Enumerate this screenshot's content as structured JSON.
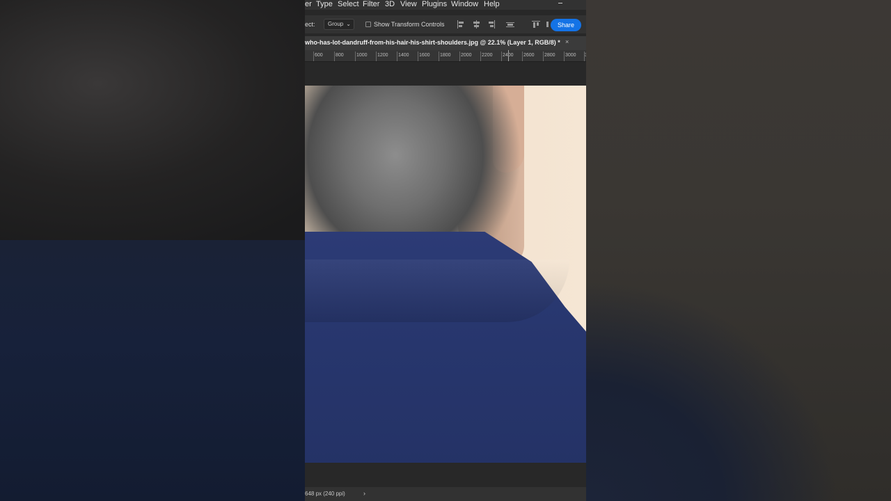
{
  "menu": [
    "er",
    "Type",
    "Select",
    "Filter",
    "3D",
    "View",
    "Plugins",
    "Window",
    "Help"
  ],
  "options": {
    "label": "ect:",
    "select_value": "Group",
    "checkbox_label": "Show Transform Controls",
    "share_label": "Share"
  },
  "document": {
    "tab_title": "who-has-lot-dandruff-from-his-hair-his-shirt-shoulders.jpg @ 22.1% (Layer 1, RGB/8) *",
    "close_glyph": "×"
  },
  "ruler": [
    "600",
    "800",
    "1000",
    "1200",
    "1400",
    "1600",
    "1800",
    "2000",
    "2200",
    "2400",
    "2600",
    "2800",
    "3000",
    "3"
  ],
  "status": {
    "text": "648 px (240 ppi)",
    "arrow": "›"
  },
  "icons": [
    "chevron-down-icon",
    "checkbox-icon",
    "align-left-icon",
    "align-center-icon",
    "align-right-icon",
    "distribute-icon",
    "align-top-icon",
    "close-icon",
    "minimize-icon"
  ]
}
